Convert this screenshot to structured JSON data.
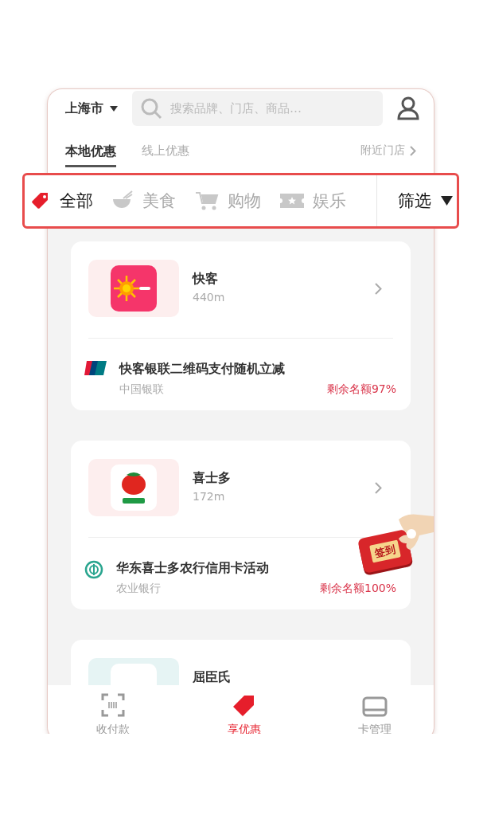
{
  "header": {
    "city": "上海市",
    "search": {
      "placeholder": "搜索品牌、门店、商品…"
    }
  },
  "tabs": [
    {
      "label": "本地优惠",
      "selected": true
    },
    {
      "label": "线上优惠",
      "selected": false
    }
  ],
  "nearby_link": "附近门店",
  "categories": [
    {
      "label": "全部",
      "selected": true
    },
    {
      "label": "美食",
      "selected": false
    },
    {
      "label": "购物",
      "selected": false
    },
    {
      "label": "娱乐",
      "selected": false
    }
  ],
  "filter": {
    "label": "筛选"
  },
  "stores": [
    {
      "name": "快客",
      "distance": "440m",
      "offer": {
        "title": "快客银联二维码支付随机立减",
        "bank": "中国银联",
        "remaining": "剩余名额97%"
      }
    },
    {
      "name": "喜士多",
      "distance": "172m",
      "offer": {
        "title": "华东喜士多农行信用卡活动",
        "bank": "农业银行",
        "remaining": "剩余名额100%"
      }
    },
    {
      "name": "屈臣氏"
    }
  ],
  "checkin": {
    "label": "签到"
  },
  "nav": [
    {
      "label": "收付款",
      "selected": false
    },
    {
      "label": "享优惠",
      "selected": true
    },
    {
      "label": "卡管理",
      "selected": false
    }
  ]
}
